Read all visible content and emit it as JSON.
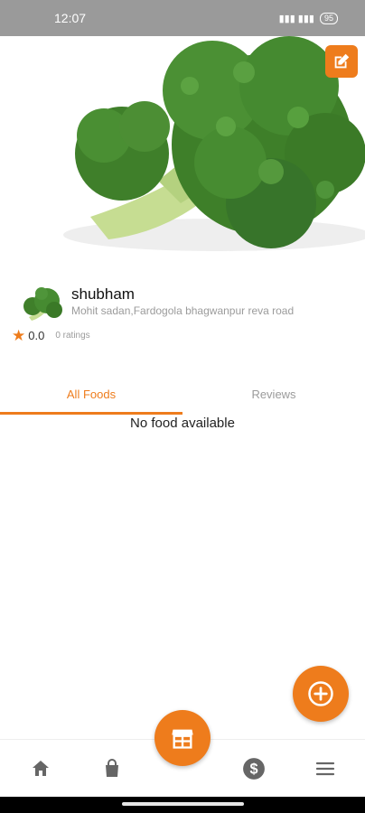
{
  "status_bar": {
    "time": "12:07",
    "battery": "95"
  },
  "shop": {
    "name": "shubham",
    "address": "Mohit sadan,Fardogola bhagwanpur reva road",
    "rating": "0.0",
    "ratings_count": "0 ratings"
  },
  "tabs": [
    {
      "label": "All Foods",
      "active": true
    },
    {
      "label": "Reviews",
      "active": false
    }
  ],
  "empty_state": "No food available",
  "colors": {
    "accent": "#ee7c1c",
    "muted_text": "#9b9b9b",
    "status_bar": "#9a9a9a"
  },
  "icons": {
    "edit": "edit-icon",
    "add": "add-circle-icon",
    "store": "store-icon",
    "home": "home-icon",
    "bag": "shopping-bag-icon",
    "dollar": "dollar-icon",
    "menu": "menu-icon"
  }
}
